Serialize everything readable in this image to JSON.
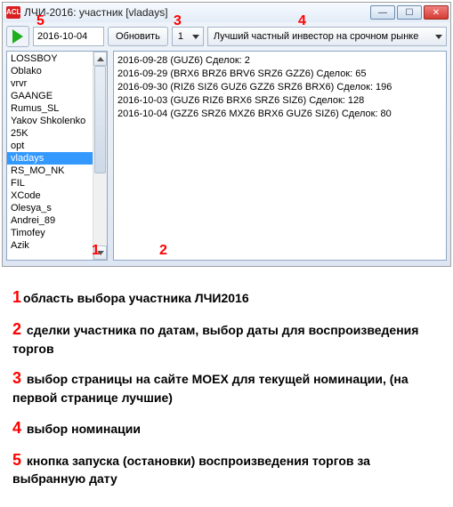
{
  "window": {
    "title": "ЛЧИ-2016: участник [vladays]"
  },
  "toolbar": {
    "date": "2016-10-04",
    "refresh_label": "Обновить",
    "page_selected": "1",
    "nomination_selected": "Лучший частный инвестор на срочном рынке"
  },
  "overlay_numbers": {
    "n3": "3",
    "n4": "4",
    "n5": "5",
    "n1": "1",
    "n2": "2"
  },
  "participants": [
    "LOSSBOY",
    "Oblako",
    "vrvr",
    "GAANGE",
    "Rumus_SL",
    "Yakov Shkolenko",
    "25K",
    "opt",
    "vladays",
    "RS_MO_NK",
    "FIL",
    "XCode",
    "Olesya_s",
    "Andrei_89",
    "Timofey",
    "Azik"
  ],
  "selected_participant_index": 8,
  "deals": [
    "2016-09-28 (GUZ6) Сделок: 2",
    "2016-09-29 (BRX6 BRZ6 BRV6 SRZ6 GZZ6) Сделок: 65",
    "2016-09-30 (RIZ6 SIZ6 GUZ6 GZZ6 SRZ6 BRX6) Сделок: 196",
    "2016-10-03 (GUZ6 RIZ6 BRX6 SRZ6 SIZ6) Сделок: 128",
    "2016-10-04 (GZZ6 SRZ6 MXZ6 BRX6 GUZ6 SIZ6) Сделок: 80"
  ],
  "legend": {
    "l1_num": "1",
    "l1_text": "область выбора участника ЛЧИ2016",
    "l2_num": "2",
    "l2_text": " сделки участника по датам, выбор даты для воспроизведения торгов",
    "l3_num": "3",
    "l3_text": " выбор страницы на сайте MOEX для текущей номинации, (на первой странице лучшие)",
    "l4_num": "4",
    "l4_text": " выбор номинации",
    "l5_num": "5",
    "l5_text": " кнопка запуска (остановки) воспроизведения торгов за выбранную дату"
  }
}
